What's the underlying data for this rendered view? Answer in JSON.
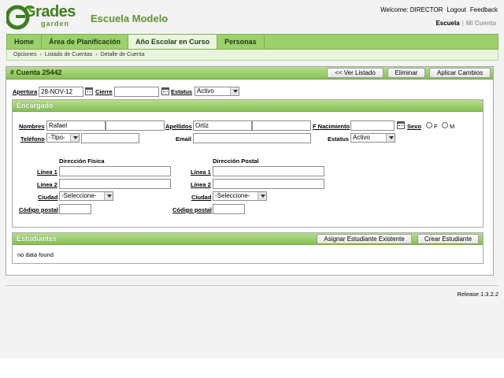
{
  "header": {
    "logo_main": "Grades",
    "logo_sub": "garden",
    "school_name": "Escuela Modelo",
    "welcome": "Welcome: DIRECTOR",
    "logout": "Logout",
    "feedback": "Feedback",
    "scope_active": "Escuela",
    "scope_inactive": "Mi Cuenta"
  },
  "nav": {
    "tabs": [
      "Home",
      "Área de Planificación",
      "Año Escolar en Curso",
      "Personas"
    ],
    "active": "Año Escolar en Curso"
  },
  "breadcrumb": [
    "Opciones",
    "Listado de Cuentas",
    "Detalle de Cuenta"
  ],
  "account": {
    "title": "# Cuenta 25442",
    "buttons": {
      "list": "<< Ver Listado",
      "delete": "Eliminar",
      "apply": "Aplicar Cambios"
    },
    "apertura_label": "Apertura",
    "apertura_value": "28-NOV-12",
    "cierre_label": "Cierre",
    "cierre_value": "",
    "estatus_label": "Estatus",
    "estatus_value": "Activo"
  },
  "encargado": {
    "title": "Encargado",
    "nombres_label": "Nombres",
    "nombres_value": "Rafael",
    "nombres2_value": "",
    "apellidos_label": "Apellidos",
    "apellidos_value": "Ortiz",
    "apellidos2_value": "",
    "fnac_label": "F Nacimiento",
    "fnac_value": "",
    "sexo_label": "Sexo",
    "sexo_f": "F",
    "sexo_m": "M",
    "telefono_label": "Teléfono",
    "telefono_type": "-Tipo-",
    "telefono_value": "",
    "email_label": "Email",
    "email_value": "",
    "estatus_label": "Estatus",
    "estatus_value": "Activo",
    "dir_fisica_title": "Dirección Física",
    "dir_postal_title": "Dirección Postal",
    "linea1_label": "Línea 1",
    "linea2_label": "Línea 2",
    "ciudad_label": "Ciudad",
    "ciudad_value": "-Seleccione-",
    "cp_label": "Código postal"
  },
  "estudiantes": {
    "title": "Estudiantes",
    "assign_button": "Asignar Estudiante Existente",
    "create_button": "Crear Estudiante",
    "empty_text": "no data found"
  },
  "footer": {
    "release": "Release 1.3.2.2"
  },
  "colors": {
    "accent": "#5e9430",
    "nav_bg": "#9bd06c",
    "header_bg": "#86c152"
  }
}
